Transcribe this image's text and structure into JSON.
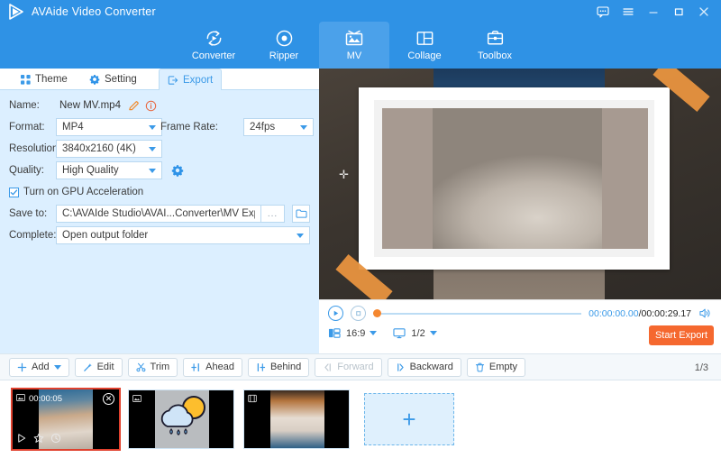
{
  "window": {
    "app_title": "AVAide Video Converter",
    "logo_icon": "play-logo-icon",
    "controls": [
      {
        "name": "feedback-icon",
        "label": "Feedback"
      },
      {
        "name": "menu-icon",
        "label": "Menu"
      },
      {
        "name": "minimize-icon",
        "label": "Minimize"
      },
      {
        "name": "maximize-icon",
        "label": "Maximize"
      },
      {
        "name": "close-icon",
        "label": "Close"
      }
    ]
  },
  "nav": {
    "tabs": [
      {
        "label": "Converter",
        "icon": "convert-arrows-icon",
        "active": false
      },
      {
        "label": "Ripper",
        "icon": "disc-icon",
        "active": false
      },
      {
        "label": "MV",
        "icon": "picture-frame-icon",
        "active": true
      },
      {
        "label": "Collage",
        "icon": "collage-grid-icon",
        "active": false
      },
      {
        "label": "Toolbox",
        "icon": "toolbox-icon",
        "active": false
      }
    ]
  },
  "panel": {
    "tabs": [
      {
        "label": "Theme",
        "icon": "grid-squares-icon",
        "active": false
      },
      {
        "label": "Setting",
        "icon": "gear-icon",
        "active": false
      },
      {
        "label": "Export",
        "icon": "export-arrow-icon",
        "active": true
      }
    ],
    "name": {
      "label": "Name:",
      "value": "New MV.mp4",
      "edit_icon": "pencil-icon",
      "info_icon": "info-circle-icon"
    },
    "format": {
      "label": "Format:",
      "value": "MP4"
    },
    "frame_rate": {
      "label": "Frame Rate:",
      "value": "24fps"
    },
    "resolution": {
      "label": "Resolution:",
      "value": "3840x2160 (4K)"
    },
    "quality": {
      "label": "Quality:",
      "value": "High Quality",
      "settings_icon": "gear-icon"
    },
    "gpu": {
      "label": "Turn on GPU Acceleration",
      "checked": true
    },
    "save_to": {
      "label": "Save to:",
      "value": "C:\\AVAIde Studio\\AVAI...Converter\\MV Exported",
      "browse_label": "...",
      "folder_icon": "folder-open-icon"
    },
    "complete": {
      "label": "Complete:",
      "value": "Open output folder"
    },
    "start_export_label": "Start Export"
  },
  "annotation": {
    "arrow_icon": "right-arrow-annotation",
    "fill": "#cfc3e0",
    "stroke": "#cc1f39"
  },
  "preview": {
    "frame_style": "white-photo-frame",
    "tape_color": "#e8933f",
    "photo_alt": "orange cat with white fluffy dog"
  },
  "player": {
    "play_icon": "play-circle-icon",
    "stop_icon": "stop-circle-icon",
    "current_time": "00:00:00.00",
    "separator": "/",
    "total_time": "00:00:29.17",
    "volume_icon": "speaker-icon",
    "aspect": {
      "icon": "aspect-ratio-icon",
      "value": "16:9"
    },
    "zoom": {
      "icon": "monitor-icon",
      "value": "1/2"
    },
    "start_export_label": "Start Export"
  },
  "toolbar": {
    "buttons": [
      {
        "label": "Add",
        "icon": "plus-icon",
        "dropdown": true,
        "disabled": false
      },
      {
        "label": "Edit",
        "icon": "magic-wand-icon",
        "dropdown": false,
        "disabled": false
      },
      {
        "label": "Trim",
        "icon": "scissors-icon",
        "dropdown": false,
        "disabled": false
      },
      {
        "label": "Ahead",
        "icon": "insert-before-icon",
        "dropdown": false,
        "disabled": false
      },
      {
        "label": "Behind",
        "icon": "insert-after-icon",
        "dropdown": false,
        "disabled": false
      },
      {
        "label": "Forward",
        "icon": "move-forward-icon",
        "dropdown": false,
        "disabled": true
      },
      {
        "label": "Backward",
        "icon": "move-backward-icon",
        "dropdown": false,
        "disabled": false
      },
      {
        "label": "Empty",
        "icon": "trash-icon",
        "dropdown": false,
        "disabled": false
      }
    ],
    "page_indicator": "1/3"
  },
  "filmstrip": {
    "items": [
      {
        "duration": "00:00:05",
        "type_icon": "image-icon",
        "selected": true,
        "close_icon": "close-circle-icon",
        "tools": [
          "play-icon",
          "star-icon",
          "clock-icon"
        ]
      },
      {
        "duration": "",
        "type_icon": "image-icon",
        "selected": false
      },
      {
        "duration": "",
        "type_icon": "film-icon",
        "selected": false
      }
    ],
    "add_tile": {
      "icon": "plus-icon",
      "label": "+"
    }
  }
}
